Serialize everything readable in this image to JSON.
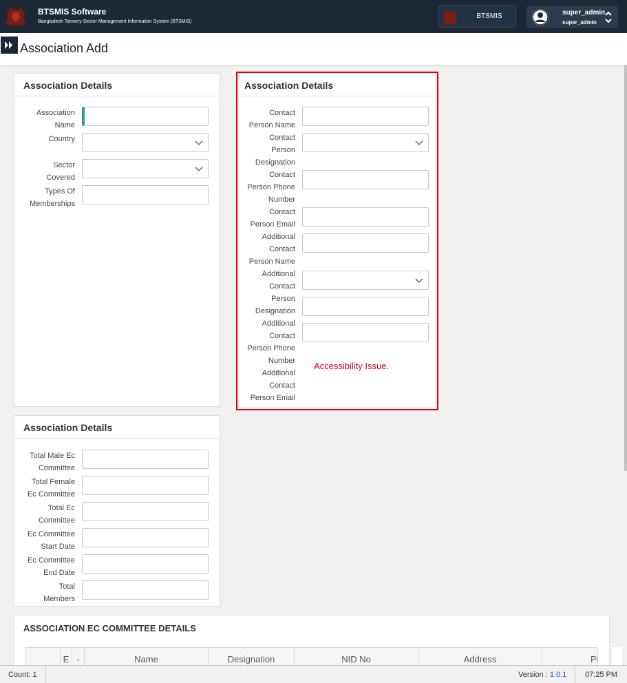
{
  "header": {
    "app_name": "BTSMIS Software",
    "app_subtitle": "Bangladesh Tannery Sector Management Information System (BTSMIS)",
    "org_label": "BTSMIS",
    "user_name": "super_admin",
    "user_role": "super_admin"
  },
  "page": {
    "title": "Association Add"
  },
  "card_general": {
    "title": "Association Details",
    "fields": [
      {
        "label_lines": [
          "Association",
          "Name"
        ]
      },
      {
        "label_lines": [
          "Country"
        ]
      },
      {
        "label_lines": [
          "Sector",
          "Covered"
        ]
      },
      {
        "label_lines": [
          "Types Of",
          "Memberships"
        ]
      }
    ]
  },
  "card_contact": {
    "title": "Association Details",
    "labels": [
      "Contact",
      "Person Name",
      "Contact",
      "Person",
      "Designation",
      "Contact",
      "Person Phone",
      "Number",
      "Contact",
      "Person Email",
      "Additional",
      "Contact",
      "Person Name",
      "Additional",
      "Contact",
      "Person",
      "Designation",
      "Additional",
      "Contact",
      "Person Phone",
      "Number",
      "Additional",
      "Contact",
      "Person Email"
    ]
  },
  "card_committee": {
    "title": "Association Details",
    "fields": [
      {
        "label_lines": [
          "Total Male Ec",
          "Committee"
        ]
      },
      {
        "label_lines": [
          "Total Female",
          "Ec Committee"
        ]
      },
      {
        "label_lines": [
          "Total Ec",
          "Committee"
        ]
      },
      {
        "label_lines": [
          "Ec Committee",
          "Start Date"
        ]
      },
      {
        "label_lines": [
          "Ec Committee",
          "End Date"
        ]
      },
      {
        "label_lines": [
          "Total",
          "Members"
        ]
      }
    ]
  },
  "annotation": {
    "text": "Accessibility Issue.",
    "color": "#e0001a"
  },
  "ec_section": {
    "title": "ASSOCIATION EC COMMITTEE DETAILS",
    "columns": [
      "",
      "E",
      "-",
      "Name",
      "Designation",
      "NID No",
      "Address",
      "Pl"
    ]
  },
  "statusbar": {
    "count": "Count: 1",
    "version_label": "Version : ",
    "version": "1.0.1",
    "time": "07:25 PM"
  },
  "colors": {
    "header_bg": "#1c2838",
    "focus_accent": "#27a08b",
    "highlight": "#e0001a"
  }
}
